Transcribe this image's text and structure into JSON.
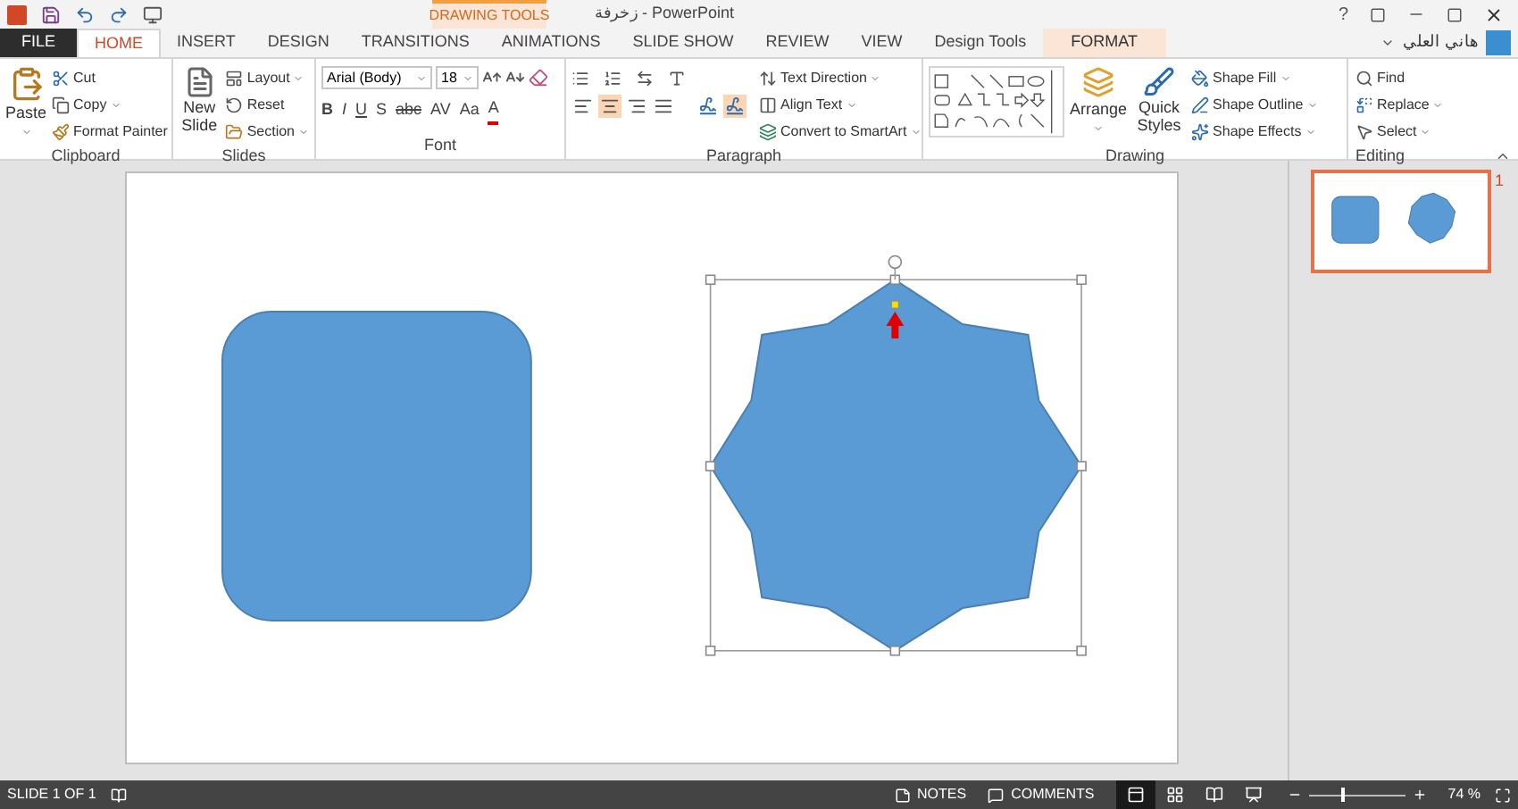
{
  "window": {
    "title": "زخرفة - PowerPoint",
    "help": "?",
    "user_name": "هاني العلي",
    "contextual_group": "DRAWING TOOLS"
  },
  "tabs": [
    {
      "label": "FILE",
      "kind": "file",
      "selected": false
    },
    {
      "label": "HOME",
      "kind": "normal",
      "selected": true
    },
    {
      "label": "INSERT",
      "kind": "normal",
      "selected": false
    },
    {
      "label": "DESIGN",
      "kind": "normal",
      "selected": false
    },
    {
      "label": "TRANSITIONS",
      "kind": "normal",
      "selected": false
    },
    {
      "label": "ANIMATIONS",
      "kind": "normal",
      "selected": false
    },
    {
      "label": "SLIDE SHOW",
      "kind": "normal",
      "selected": false
    },
    {
      "label": "REVIEW",
      "kind": "normal",
      "selected": false
    },
    {
      "label": "VIEW",
      "kind": "normal",
      "selected": false
    },
    {
      "label": "Design Tools",
      "kind": "normal",
      "selected": false
    },
    {
      "label": "FORMAT",
      "kind": "contextual",
      "selected": false
    }
  ],
  "clipboard": {
    "label": "Clipboard",
    "paste": "Paste",
    "items": [
      "Cut",
      "Copy",
      "Format Painter"
    ]
  },
  "slides_group": {
    "label": "Slides",
    "new_slide": "New Slide",
    "items": [
      "Layout",
      "Reset",
      "Section"
    ]
  },
  "font": {
    "label": "Font",
    "name": "Arial (Body)",
    "size": "18",
    "styles": [
      "B",
      "I",
      "U",
      "S",
      "abc",
      "AV",
      "Aa",
      "A"
    ]
  },
  "paragraph": {
    "label": "Paragraph",
    "alignment": [
      {
        "selected": false
      },
      {
        "selected": true
      },
      {
        "selected": false
      },
      {
        "selected": false
      }
    ],
    "direction": [
      {
        "selected": false
      },
      {
        "selected": true
      }
    ],
    "items": [
      "Text Direction",
      "Align Text",
      "Convert to SmartArt"
    ]
  },
  "drawing": {
    "label": "Drawing",
    "arrange": "Arrange",
    "quick_styles": "Quick Styles",
    "items": [
      "Shape Fill",
      "Shape Outline",
      "Shape Effects"
    ]
  },
  "editing": {
    "label": "Editing",
    "items": [
      "Find",
      "Replace",
      "Select"
    ]
  },
  "thumbnails": [
    {
      "number": "1",
      "selected": true
    }
  ],
  "status_bar": {
    "slide": "SLIDE 1 OF 1",
    "notes": "NOTES",
    "comments": "COMMENTS",
    "views": [
      {
        "selected": true
      },
      {
        "selected": false
      },
      {
        "selected": false
      },
      {
        "selected": false
      }
    ],
    "zoom": {
      "level": 0.33,
      "reading": "74 %"
    }
  }
}
